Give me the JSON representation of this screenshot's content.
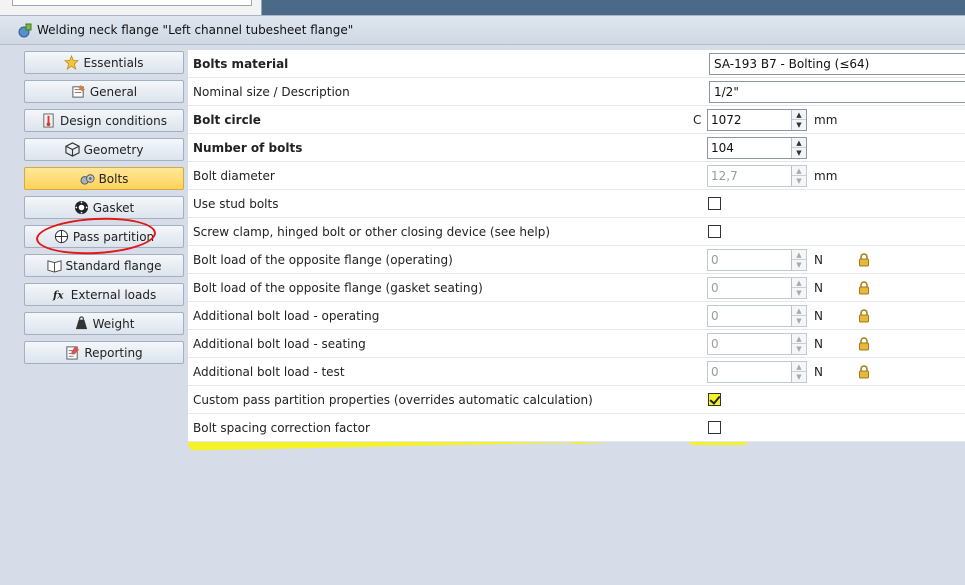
{
  "window": {
    "title": "Welding neck flange \"Left channel tubesheet flange\"",
    "accent_color": "#ffd35a",
    "annotation_color": "#e01818",
    "highlight_color": "#f6f22a"
  },
  "sidebar": {
    "items": [
      {
        "label": "Essentials",
        "icon": "star-icon"
      },
      {
        "label": "General",
        "icon": "general-icon"
      },
      {
        "label": "Design conditions",
        "icon": "thermometer-icon"
      },
      {
        "label": "Geometry",
        "icon": "cube-icon"
      },
      {
        "label": "Bolts",
        "icon": "bolts-icon",
        "active": true
      },
      {
        "label": "Gasket",
        "icon": "gasket-icon"
      },
      {
        "label": "Pass partition",
        "icon": "pass-partition-icon",
        "circled": true
      },
      {
        "label": "Standard flange",
        "icon": "book-icon"
      },
      {
        "label": "External loads",
        "icon": "fx-icon"
      },
      {
        "label": "Weight",
        "icon": "weight-icon"
      },
      {
        "label": "Reporting",
        "icon": "reporting-icon"
      }
    ]
  },
  "properties": {
    "bolts_material": {
      "label": "Bolts material",
      "value": "SA-193 B7 - Bolting (≤64)"
    },
    "nominal_size": {
      "label": "Nominal size / Description",
      "value": "1/2\""
    },
    "bolt_circle": {
      "label": "Bolt circle",
      "prefix": "C",
      "value": "1072",
      "unit": "mm"
    },
    "number_of_bolts": {
      "label": "Number of bolts",
      "value": "104"
    },
    "bolt_diameter": {
      "label": "Bolt diameter",
      "value": "12,7",
      "unit": "mm"
    },
    "use_stud_bolts": {
      "label": "Use stud bolts",
      "checked": false
    },
    "screw_clamp": {
      "label": "Screw clamp, hinged bolt or other closing device (see help)",
      "checked": false
    },
    "opp_operating": {
      "label": "Bolt load of the opposite flange (operating)",
      "value": "0",
      "unit": "N"
    },
    "opp_seating": {
      "label": "Bolt load of the opposite flange (gasket seating)",
      "value": "0",
      "unit": "N"
    },
    "add_operating": {
      "label": "Additional bolt load - operating",
      "value": "0",
      "unit": "N"
    },
    "add_seating": {
      "label": "Additional bolt load - seating",
      "value": "0",
      "unit": "N"
    },
    "add_test": {
      "label": "Additional bolt load - test",
      "value": "0",
      "unit": "N"
    },
    "custom_pass": {
      "label": "Custom pass partition properties (overrides automatic calculation)",
      "checked": true
    },
    "spacing_factor": {
      "label": "Bolt spacing correction factor",
      "checked": false
    }
  }
}
